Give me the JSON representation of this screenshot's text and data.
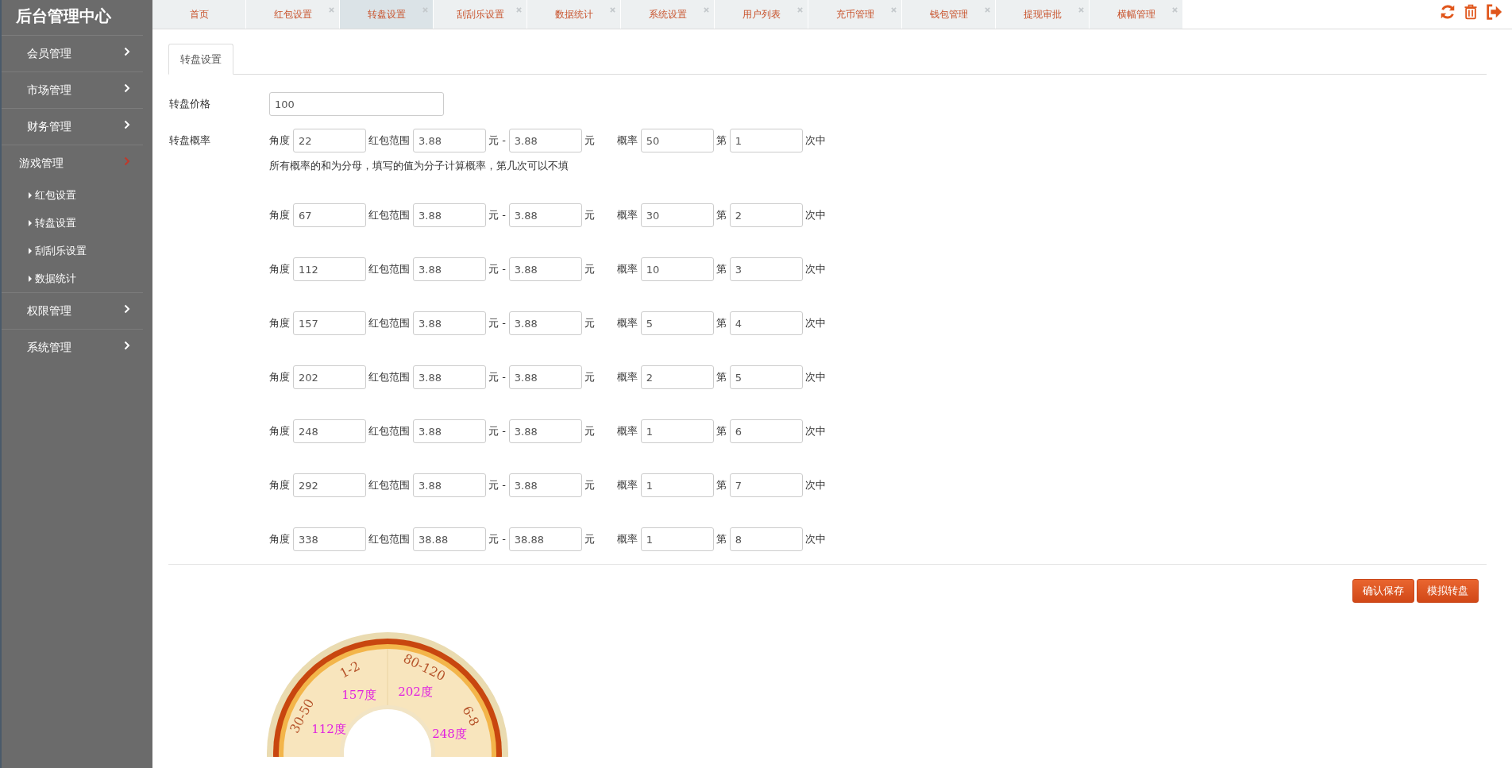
{
  "app_title": "后台管理中心",
  "sidebar": {
    "items": [
      {
        "label": "会员管理",
        "expanded": false
      },
      {
        "label": "市场管理",
        "expanded": false
      },
      {
        "label": "财务管理",
        "expanded": false
      },
      {
        "label": "游戏管理",
        "expanded": true,
        "children": [
          {
            "label": "红包设置"
          },
          {
            "label": "转盘设置"
          },
          {
            "label": "刮刮乐设置"
          },
          {
            "label": "数据统计"
          }
        ]
      },
      {
        "label": "权限管理",
        "expanded": false
      },
      {
        "label": "系统管理",
        "expanded": false
      }
    ]
  },
  "tabs": [
    {
      "label": "首页",
      "selected": false,
      "closable": false
    },
    {
      "label": "红包设置",
      "selected": false,
      "closable": true
    },
    {
      "label": "转盘设置",
      "selected": true,
      "closable": true
    },
    {
      "label": "刮刮乐设置",
      "selected": false,
      "closable": true
    },
    {
      "label": "数据统计",
      "selected": false,
      "closable": true
    },
    {
      "label": "系统设置",
      "selected": false,
      "closable": true
    },
    {
      "label": "用户列表",
      "selected": false,
      "closable": true
    },
    {
      "label": "充币管理",
      "selected": false,
      "closable": true
    },
    {
      "label": "钱包管理",
      "selected": false,
      "closable": true
    },
    {
      "label": "提现审批",
      "selected": false,
      "closable": true
    },
    {
      "label": "横幅管理",
      "selected": false,
      "closable": true
    }
  ],
  "page_tabs": [
    {
      "label": "转盘设置",
      "selected": true
    }
  ],
  "form": {
    "price_label": "转盘价格",
    "price_value": "100",
    "rate_label": "转盘概率",
    "hint": "所有概率的和为分母，填写的值为分子计算概率，第几次可以不填",
    "rows": [
      {
        "angle_label": "角度",
        "angle": "22",
        "range_label": "红包范围",
        "min": "3.88",
        "sep": "元 -",
        "max": "3.88",
        "unit": "元",
        "rate_label": "概率",
        "rate": "50",
        "nth_label": "第",
        "nth": "1",
        "nth_suffix": "次中"
      },
      {
        "angle_label": "角度",
        "angle": "67",
        "range_label": "红包范围",
        "min": "3.88",
        "sep": "元 -",
        "max": "3.88",
        "unit": "元",
        "rate_label": "概率",
        "rate": "30",
        "nth_label": "第",
        "nth": "2",
        "nth_suffix": "次中"
      },
      {
        "angle_label": "角度",
        "angle": "112",
        "range_label": "红包范围",
        "min": "3.88",
        "sep": "元 -",
        "max": "3.88",
        "unit": "元",
        "rate_label": "概率",
        "rate": "10",
        "nth_label": "第",
        "nth": "3",
        "nth_suffix": "次中"
      },
      {
        "angle_label": "角度",
        "angle": "157",
        "range_label": "红包范围",
        "min": "3.88",
        "sep": "元 -",
        "max": "3.88",
        "unit": "元",
        "rate_label": "概率",
        "rate": "5",
        "nth_label": "第",
        "nth": "4",
        "nth_suffix": "次中"
      },
      {
        "angle_label": "角度",
        "angle": "202",
        "range_label": "红包范围",
        "min": "3.88",
        "sep": "元 -",
        "max": "3.88",
        "unit": "元",
        "rate_label": "概率",
        "rate": "2",
        "nth_label": "第",
        "nth": "5",
        "nth_suffix": "次中"
      },
      {
        "angle_label": "角度",
        "angle": "248",
        "range_label": "红包范围",
        "min": "3.88",
        "sep": "元 -",
        "max": "3.88",
        "unit": "元",
        "rate_label": "概率",
        "rate": "1",
        "nth_label": "第",
        "nth": "6",
        "nth_suffix": "次中"
      },
      {
        "angle_label": "角度",
        "angle": "292",
        "range_label": "红包范围",
        "min": "3.88",
        "sep": "元 -",
        "max": "3.88",
        "unit": "元",
        "rate_label": "概率",
        "rate": "1",
        "nth_label": "第",
        "nth": "7",
        "nth_suffix": "次中"
      },
      {
        "angle_label": "角度",
        "angle": "338",
        "range_label": "红包范围",
        "min": "38.88",
        "sep": "元 -",
        "max": "38.88",
        "unit": "元",
        "rate_label": "概率",
        "rate": "1",
        "nth_label": "第",
        "nth": "8",
        "nth_suffix": "次中"
      }
    ]
  },
  "buttons": [
    "确认保存",
    "模拟转盘"
  ],
  "wheel": {
    "prizes": [
      "30-50",
      "1-2",
      "80-120",
      "6-8"
    ],
    "angles": [
      "112度",
      "157度",
      "202度",
      "248度"
    ]
  }
}
